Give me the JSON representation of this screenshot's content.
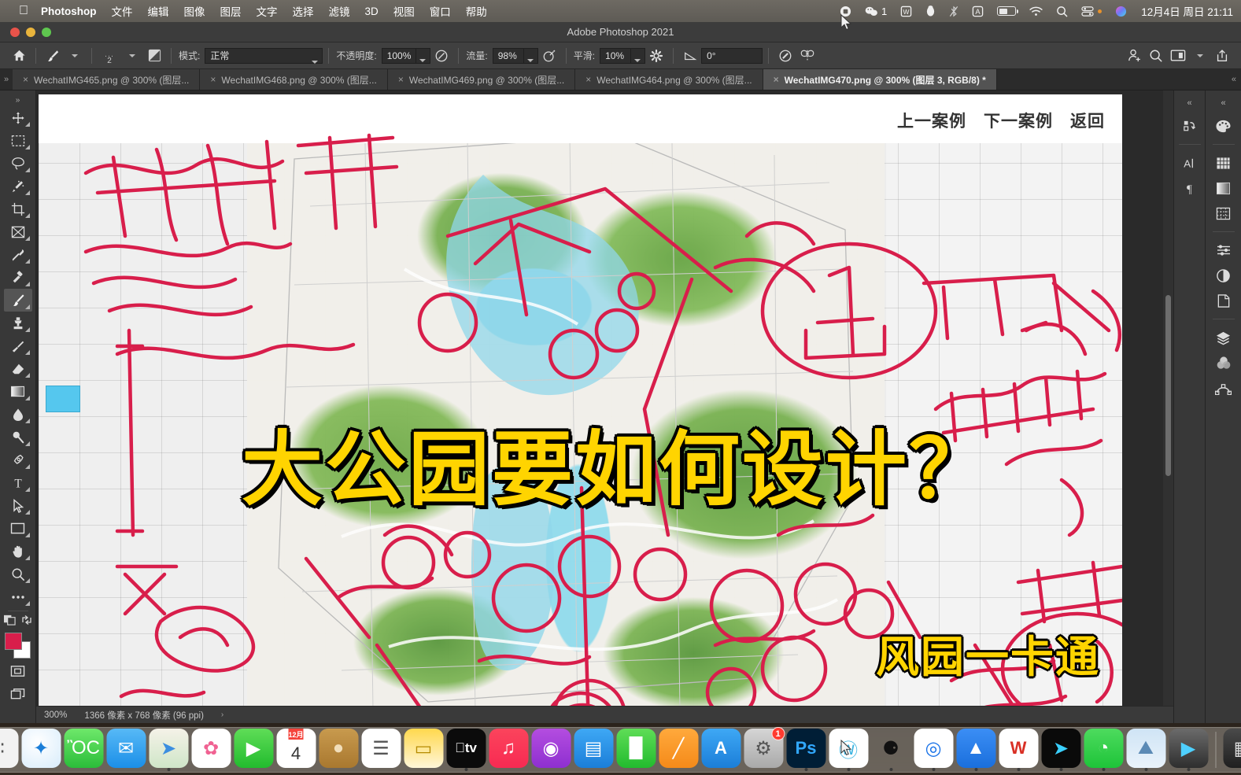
{
  "menubar": {
    "apple_icon": "apple-icon",
    "app_name": "Photoshop",
    "items": [
      "文件",
      "编辑",
      "图像",
      "图层",
      "文字",
      "选择",
      "滤镜",
      "3D",
      "视图",
      "窗口",
      "帮助"
    ],
    "status_icons": [
      {
        "name": "screen-record-icon",
        "glyph": "⏺"
      },
      {
        "name": "wechat-status-icon",
        "glyph": "◎",
        "count": "1"
      },
      {
        "name": "wps-status-icon",
        "glyph": "W"
      },
      {
        "name": "qq-status-icon",
        "glyph": "●"
      },
      {
        "name": "bluetooth-off-icon",
        "glyph": "␢"
      },
      {
        "name": "input-source-icon",
        "glyph": "A"
      },
      {
        "name": "battery-icon",
        "glyph": "battery"
      },
      {
        "name": "wifi-icon",
        "glyph": "◔"
      },
      {
        "name": "spotlight-search-icon",
        "glyph": "⌕"
      },
      {
        "name": "control-center-icon",
        "glyph": "☷"
      },
      {
        "name": "siri-icon",
        "glyph": "●"
      }
    ],
    "clock": "12月4日 周日  21:11"
  },
  "window": {
    "title": "Adobe Photoshop 2021",
    "traffic_lights": [
      "close",
      "minimize",
      "zoom"
    ]
  },
  "options_bar": {
    "home_icon": "home-icon",
    "brush_preset_icon": "brush-icon",
    "brush_size": "2",
    "brush_panel_icon": "brush-settings-icon",
    "mode_label": "模式:",
    "mode_value": "正常",
    "opacity_label": "不透明度:",
    "opacity_value": "100%",
    "pressure_opacity_icon": "pressure-opacity-icon",
    "flow_label": "流量:",
    "flow_value": "98%",
    "airbrush_icon": "airbrush-icon",
    "smoothing_label": "平滑:",
    "smoothing_value": "10%",
    "smoothing_settings_icon": "gear-icon",
    "angle_icon": "angle-icon",
    "angle_value": "0°",
    "pressure_size_icon": "pressure-size-icon",
    "symmetry_icon": "symmetry-butterfly-icon",
    "right_icons": [
      {
        "name": "add-collaborator-icon"
      },
      {
        "name": "search-icon"
      },
      {
        "name": "workspace-icon"
      },
      {
        "name": "workspace-caret-icon"
      },
      {
        "name": "share-icon"
      }
    ]
  },
  "tabs": [
    {
      "label": "WechatIMG465.png @ 300% (图层...",
      "active": false
    },
    {
      "label": "WechatIMG468.png @ 300% (图层...",
      "active": false
    },
    {
      "label": "WechatIMG469.png @ 300% (图层...",
      "active": false
    },
    {
      "label": "WechatIMG464.png @ 300% (图层...",
      "active": false
    },
    {
      "label": "WechatIMG470.png @ 300% (图层 3, RGB/8) *",
      "active": true
    }
  ],
  "toolbar": {
    "tools": [
      {
        "name": "move-tool",
        "glyph": "✛"
      },
      {
        "name": "rectangular-marquee-tool",
        "glyph": "⬚"
      },
      {
        "name": "lasso-tool",
        "glyph": "◯"
      },
      {
        "name": "magic-wand-tool",
        "glyph": "✦"
      },
      {
        "name": "crop-tool",
        "glyph": "⯭"
      },
      {
        "name": "frame-tool",
        "glyph": "⌧"
      },
      {
        "name": "eyedropper-tool",
        "glyph": "✐"
      },
      {
        "name": "spot-healing-brush-tool",
        "glyph": "✒"
      },
      {
        "name": "brush-tool",
        "glyph": "✎",
        "active": true
      },
      {
        "name": "clone-stamp-tool",
        "glyph": "⚑"
      },
      {
        "name": "history-brush-tool",
        "glyph": "✑"
      },
      {
        "name": "eraser-tool",
        "glyph": "▱"
      },
      {
        "name": "gradient-tool",
        "glyph": "■"
      },
      {
        "name": "blur-tool",
        "glyph": "●"
      },
      {
        "name": "dodge-tool",
        "glyph": "○"
      },
      {
        "name": "pen-tool",
        "glyph": "✒"
      },
      {
        "name": "type-tool",
        "glyph": "T"
      },
      {
        "name": "path-selection-tool",
        "glyph": "➤"
      },
      {
        "name": "rectangle-tool",
        "glyph": "▭"
      },
      {
        "name": "hand-tool",
        "glyph": "✋"
      },
      {
        "name": "zoom-tool",
        "glyph": "⌕"
      },
      {
        "name": "edit-toolbar-tool",
        "glyph": "⋯"
      }
    ],
    "quickmask_icon": "quick-mask-icon",
    "swap-colors_icon": "swap-colors-icon",
    "foreground_color": "#D81E4B",
    "background_color": "#FFFFFF",
    "screen_mode_icon": "screen-mode-icon",
    "arrange_icon": "arrange-documents-icon"
  },
  "canvas": {
    "nav_links": [
      "上一案例",
      "下一案例",
      "返回"
    ],
    "headline": "大公园要如何设计？",
    "watermark": "风园一卡通",
    "annotation_color": "#D81E4B"
  },
  "statusbar": {
    "zoom": "300%",
    "dimensions": "1366 像素 x 768 像素 (96 ppi)",
    "expand_arrow": "›"
  },
  "right_panels": {
    "rail_a": [
      {
        "name": "history-panel-icon",
        "glyph": "↺"
      },
      {
        "name": "character-panel-icon",
        "glyph": "A"
      },
      {
        "name": "paragraph-panel-icon",
        "glyph": "¶"
      }
    ],
    "rail_b": [
      {
        "name": "color-panel-icon",
        "glyph": "◕"
      },
      {
        "name": "swatches-panel-icon",
        "glyph": "▒"
      },
      {
        "name": "gradients-panel-icon",
        "glyph": "▨"
      },
      {
        "name": "patterns-panel-icon",
        "glyph": "▓"
      },
      {
        "name": "adjustments-panel-icon",
        "glyph": "≡"
      },
      {
        "name": "contrast-panel-icon",
        "glyph": "◑"
      },
      {
        "name": "libraries-panel-icon",
        "glyph": "◰"
      },
      {
        "name": "layers-panel-icon",
        "glyph": "❖"
      },
      {
        "name": "channels-panel-icon",
        "glyph": "◎"
      },
      {
        "name": "paths-panel-icon",
        "glyph": "⌒"
      }
    ],
    "collapse_icon": "collapse-panels-icon"
  },
  "dock": {
    "items": [
      {
        "name": "finder",
        "glyph": "☺",
        "bg": "linear-gradient(to bottom,#3ea8f5,#1b7ed8)",
        "color": "#fff",
        "running": true
      },
      {
        "name": "launchpad",
        "glyph": "∷",
        "bg": "#f2f2f2",
        "color": "#555",
        "running": false
      },
      {
        "name": "safari",
        "glyph": "✦",
        "bg": "radial-gradient(circle at 40% 35%,#ffffff,#d8ecfb)",
        "color": "#1b7ed8",
        "running": false
      },
      {
        "name": "messages",
        "glyph": "ὊC",
        "bg": "linear-gradient(to bottom,#6ee86a,#2bbd3a)",
        "color": "#fff",
        "running": false
      },
      {
        "name": "mail",
        "glyph": "✉",
        "bg": "linear-gradient(to bottom,#57b9f6,#1b8fe8)",
        "color": "#fff",
        "running": false
      },
      {
        "name": "maps",
        "glyph": "➤",
        "bg": "linear-gradient(to bottom,#f5f2e8,#cfe6c8)",
        "color": "#3b8ee0",
        "running": true
      },
      {
        "name": "photos",
        "glyph": "✿",
        "bg": "#ffffff",
        "color": "#f06292",
        "running": false
      },
      {
        "name": "facetime",
        "glyph": "▶",
        "bg": "linear-gradient(to bottom,#5fdd57,#22bb2e)",
        "color": "#fff",
        "running": false
      },
      {
        "name": "calendar",
        "glyph": "calendar",
        "bg": "#ffffff",
        "color": "#333",
        "running": false,
        "month": "12月",
        "day": "4"
      },
      {
        "name": "contacts",
        "glyph": "●",
        "bg": "linear-gradient(to bottom,#c89a4e,#a9782f)",
        "color": "#f1deba",
        "running": false
      },
      {
        "name": "reminders",
        "glyph": "☰",
        "bg": "#ffffff",
        "color": "#555",
        "running": false
      },
      {
        "name": "notes",
        "glyph": "▭",
        "bg": "linear-gradient(to bottom,#ffd84d,#fff6d8)",
        "color": "#b58b00",
        "running": false
      },
      {
        "name": "apple-tv",
        "glyph": "tv",
        "bg": "#0b0b0b",
        "color": "#fff",
        "running": true
      },
      {
        "name": "music",
        "glyph": "♫",
        "bg": "linear-gradient(to bottom,#fb445c,#f82a52)",
        "color": "#fff",
        "running": false
      },
      {
        "name": "podcasts",
        "glyph": "◉",
        "bg": "linear-gradient(to bottom,#b44de0,#8e2fd0)",
        "color": "#fff",
        "running": false
      },
      {
        "name": "keynote",
        "glyph": "▤",
        "bg": "linear-gradient(to bottom,#3ea8f5,#1b7ed8)",
        "color": "#fff",
        "running": false
      },
      {
        "name": "numbers",
        "glyph": "█",
        "bg": "linear-gradient(to bottom,#5fdd57,#22bb2e)",
        "color": "#fff",
        "running": false
      },
      {
        "name": "pages",
        "glyph": "╱",
        "bg": "linear-gradient(to bottom,#ffa93c,#f58a19)",
        "color": "#fff",
        "running": false
      },
      {
        "name": "app-store",
        "glyph": "A",
        "bg": "linear-gradient(to bottom,#3ea8f5,#1b7ed8)",
        "color": "#fff",
        "running": false
      },
      {
        "name": "system-preferences",
        "glyph": "⚙",
        "bg": "linear-gradient(to bottom,#d5d5d5,#a9a9a9)",
        "color": "#555",
        "running": false,
        "badge": "1"
      },
      {
        "name": "photoshop",
        "glyph": "Ps",
        "bg": "#001e36",
        "color": "#31a8ff",
        "running": true
      },
      {
        "name": "wps-writer",
        "glyph": "Ⓦ",
        "bg": "#ffffff",
        "color": "#3bb3e0",
        "running": true
      },
      {
        "name": "qq",
        "glyph": "⚈",
        "bg": "transparent",
        "color": "#111",
        "running": true
      },
      {
        "name": "chrome",
        "glyph": "◎",
        "bg": "#ffffff",
        "color": "#1a73e8",
        "running": true
      },
      {
        "name": "bandizip",
        "glyph": "▲",
        "bg": "linear-gradient(to bottom,#3b8ef5,#1a6fdc)",
        "color": "#fff",
        "running": true
      },
      {
        "name": "wps-office",
        "glyph": "W",
        "bg": "#ffffff",
        "color": "#d93025",
        "running": true
      },
      {
        "name": "terminal",
        "glyph": "➤",
        "bg": "#0a0a0a",
        "color": "#3ad0ff",
        "running": true
      },
      {
        "name": "wechat",
        "glyph": "◔",
        "bg": "linear-gradient(to bottom,#4ddb5e,#1ec439)",
        "color": "#fff",
        "running": true
      },
      {
        "name": "preview",
        "glyph": "⛰",
        "bg": "linear-gradient(to bottom,#cfe4f5,#eaf3fb)",
        "color": "#5b8ab5",
        "running": true
      },
      {
        "name": "quicktime",
        "glyph": "▶",
        "bg": "linear-gradient(to bottom,#6b6b6b,#2e2e2e)",
        "color": "#4fd0ff",
        "running": true
      },
      {
        "name": "downloads-folder",
        "glyph": "▦",
        "bg": "linear-gradient(to bottom,#4a4a4a,#1f1f1f)",
        "color": "#ddd",
        "running": false
      },
      {
        "name": "trash",
        "glyph": "Ὕ1",
        "bg": "transparent",
        "color": "#dcdcdc",
        "running": false
      }
    ]
  }
}
